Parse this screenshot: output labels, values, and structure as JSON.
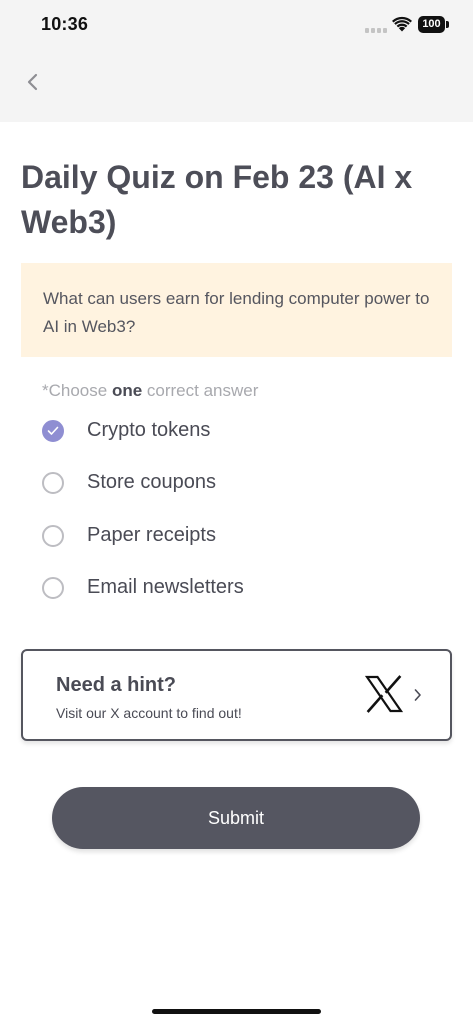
{
  "status_bar": {
    "time": "10:36",
    "battery": "100"
  },
  "nav": {
    "back_icon": "chevron-left-icon"
  },
  "quiz": {
    "title": "Daily Quiz on Feb 23 (AI x Web3)",
    "question": "What can users earn for lending computer power to AI in Web3?",
    "instruction_prefix": "*Choose ",
    "instruction_emphasis": "one",
    "instruction_suffix": " correct answer",
    "selected_index": 0,
    "options": [
      {
        "label": "Crypto tokens",
        "selected": true
      },
      {
        "label": "Store coupons",
        "selected": false
      },
      {
        "label": "Paper receipts",
        "selected": false
      },
      {
        "label": "Email newsletters",
        "selected": false
      }
    ]
  },
  "hint": {
    "title": "Need a hint?",
    "subtitle": "Visit our X account to find out!",
    "icon": "x-logo-icon"
  },
  "submit": {
    "label": "Submit"
  },
  "colors": {
    "accent": "#8f8ed2",
    "question_bg": "#fff3e0",
    "button_bg": "#555661",
    "header_bg": "#f4f4f4"
  }
}
